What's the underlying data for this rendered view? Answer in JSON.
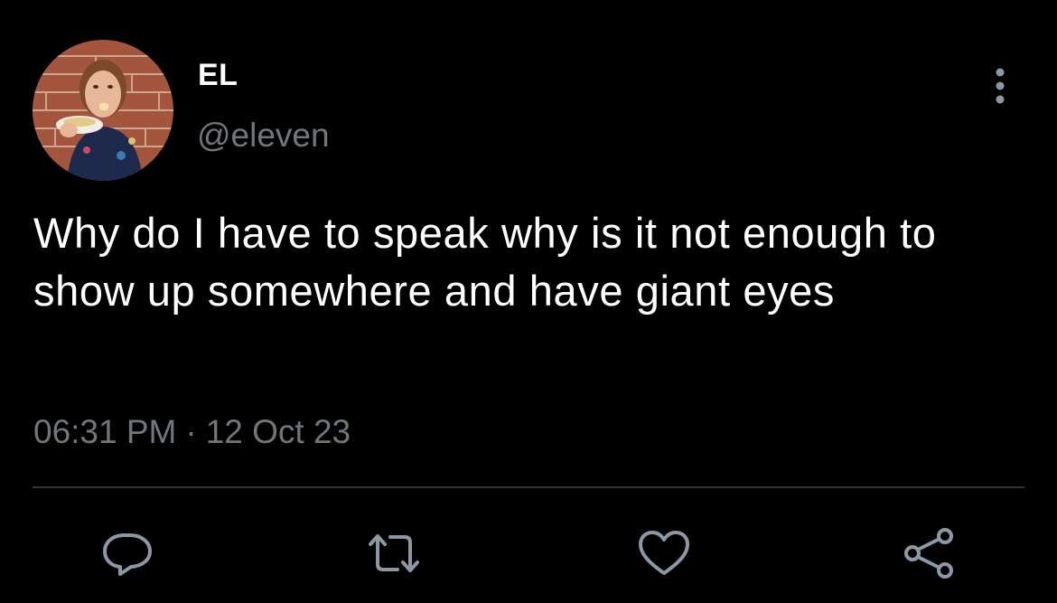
{
  "user": {
    "display_name": "EL",
    "handle": "@eleven",
    "avatar_icon": "profile-photo"
  },
  "tweet": {
    "text": "Why do I have to speak why is it not enough to show up somewhere and have giant eyes",
    "time": "06:31 PM",
    "separator": "·",
    "date": "12 Oct 23"
  },
  "actions": [
    {
      "name": "reply",
      "icon": "speech-bubble-icon"
    },
    {
      "name": "retweet",
      "icon": "retweet-arrows-icon"
    },
    {
      "name": "like",
      "icon": "heart-icon"
    },
    {
      "name": "share",
      "icon": "share-nodes-icon"
    }
  ],
  "colors": {
    "background": "#000000",
    "primary_text": "#ffffff",
    "secondary_text": "#71767b",
    "divider": "#2f3336",
    "icon": "#8b98a5"
  }
}
